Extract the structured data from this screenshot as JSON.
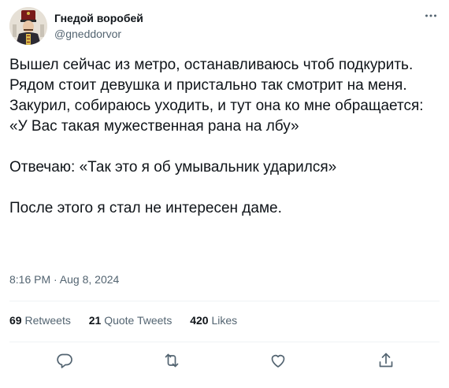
{
  "author": {
    "display_name": "Гнедой воробей",
    "handle": "@gneddorvor",
    "avatar_icon": "hussar-portrait-avatar"
  },
  "menu_icon": "more-dots-icon",
  "tweet": {
    "paragraphs": [
      "Вышел сейчас из метро, останавливаюсь чтоб подкурить. Рядом стоит девушка и пристально так смотрит на меня. Закурил, собираюсь уходить, и тут она ко мне обращается: «У Вас такая мужественная рана на лбу»",
      "Отвечаю: «Так это я об умывальник ударился»",
      "После этого я стал не интересен даме."
    ],
    "timestamp": "8:16 PM · Aug 8, 2024"
  },
  "stats": {
    "retweets_count": "69",
    "retweets_label": "Retweets",
    "quotes_count": "21",
    "quotes_label": "Quote Tweets",
    "likes_count": "420",
    "likes_label": "Likes"
  },
  "actions": {
    "reply_icon": "reply-icon",
    "retweet_icon": "retweet-icon",
    "like_icon": "like-icon",
    "share_icon": "share-icon"
  },
  "colors": {
    "text_primary": "#0f1419",
    "text_secondary": "#536471",
    "divider": "#eff3f4"
  }
}
